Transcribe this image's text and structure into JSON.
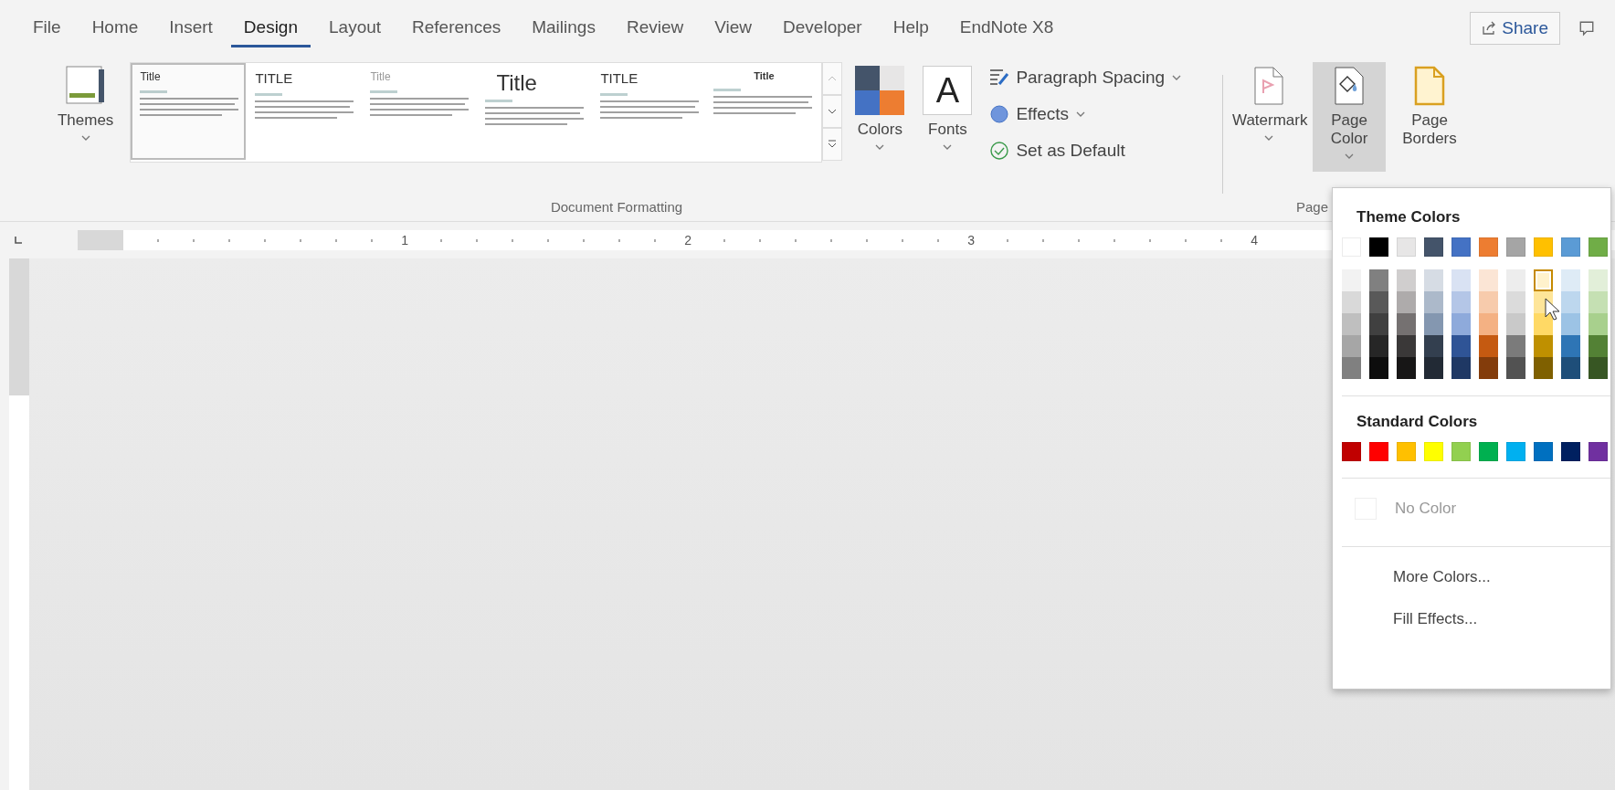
{
  "tabs": [
    {
      "label": "File",
      "selected": false
    },
    {
      "label": "Home",
      "selected": false
    },
    {
      "label": "Insert",
      "selected": false
    },
    {
      "label": "Design",
      "selected": true
    },
    {
      "label": "Layout",
      "selected": false
    },
    {
      "label": "References",
      "selected": false
    },
    {
      "label": "Mailings",
      "selected": false
    },
    {
      "label": "Review",
      "selected": false
    },
    {
      "label": "View",
      "selected": false
    },
    {
      "label": "Developer",
      "selected": false
    },
    {
      "label": "Help",
      "selected": false
    },
    {
      "label": "EndNote X8",
      "selected": false
    }
  ],
  "share_button": {
    "label": "Share"
  },
  "ribbon": {
    "themes_button": {
      "label": "Themes"
    },
    "style_gallery": [
      {
        "title": "Title",
        "kind": "basic",
        "selected": true
      },
      {
        "title": "TITLE",
        "kind": "caps",
        "selected": false
      },
      {
        "title": "Title",
        "kind": "faint",
        "selected": false
      },
      {
        "title": "Title",
        "kind": "large",
        "selected": false
      },
      {
        "title": "TITLE",
        "kind": "caps",
        "selected": false
      },
      {
        "title": "Title",
        "kind": "centered",
        "selected": false
      }
    ],
    "colors_button": {
      "label": "Colors"
    },
    "fonts_button": {
      "label": "Fonts",
      "sample": "A"
    },
    "commands": [
      {
        "label": "Paragraph Spacing",
        "kind": "spacing"
      },
      {
        "label": "Effects",
        "kind": "effects"
      },
      {
        "label": "Set as Default",
        "kind": "default"
      }
    ],
    "document_group_label": "Document Formatting",
    "page_buttons": [
      {
        "label": "Watermark",
        "kind": "watermark",
        "active": false
      },
      {
        "label": "Page Color",
        "kind": "page-color",
        "active": true
      },
      {
        "label": "Page Borders",
        "kind": "page-borders",
        "active": false
      }
    ],
    "page_group_label": "Page"
  },
  "ruler": {
    "numbers": [
      "1",
      "2",
      "3",
      "4"
    ]
  },
  "page_color_menu": {
    "theme_heading": "Theme Colors",
    "theme_colors": [
      {
        "color": "#ffffff",
        "shades": [
          {
            "color": "#f2f2f2",
            "selected": false
          },
          {
            "color": "#d9d9d9",
            "selected": false
          },
          {
            "color": "#bfbfbf",
            "selected": false
          },
          {
            "color": "#a6a6a6",
            "selected": false
          },
          {
            "color": "#808080",
            "selected": false
          }
        ]
      },
      {
        "color": "#000000",
        "shades": [
          {
            "color": "#808080",
            "selected": false
          },
          {
            "color": "#595959",
            "selected": false
          },
          {
            "color": "#404040",
            "selected": false
          },
          {
            "color": "#262626",
            "selected": false
          },
          {
            "color": "#0d0d0d",
            "selected": false
          }
        ]
      },
      {
        "color": "#e7e6e6",
        "shades": [
          {
            "color": "#d0cece",
            "selected": false
          },
          {
            "color": "#aeabab",
            "selected": false
          },
          {
            "color": "#757171",
            "selected": false
          },
          {
            "color": "#3a3838",
            "selected": false
          },
          {
            "color": "#171616",
            "selected": false
          }
        ]
      },
      {
        "color": "#44546a",
        "shades": [
          {
            "color": "#d6dce4",
            "selected": false
          },
          {
            "color": "#acb9ca",
            "selected": false
          },
          {
            "color": "#8497b0",
            "selected": false
          },
          {
            "color": "#333f4f",
            "selected": false
          },
          {
            "color": "#222a35",
            "selected": false
          }
        ]
      },
      {
        "color": "#4472c4",
        "shades": [
          {
            "color": "#d9e2f3",
            "selected": false
          },
          {
            "color": "#b4c6e7",
            "selected": false
          },
          {
            "color": "#8eaadb",
            "selected": false
          },
          {
            "color": "#2f5496",
            "selected": false
          },
          {
            "color": "#1f3864",
            "selected": false
          }
        ]
      },
      {
        "color": "#ed7d31",
        "shades": [
          {
            "color": "#fbe5d5",
            "selected": false
          },
          {
            "color": "#f7cbac",
            "selected": false
          },
          {
            "color": "#f4b183",
            "selected": false
          },
          {
            "color": "#c55a11",
            "selected": false
          },
          {
            "color": "#833c0b",
            "selected": false
          }
        ]
      },
      {
        "color": "#a5a5a5",
        "shades": [
          {
            "color": "#ededed",
            "selected": false
          },
          {
            "color": "#dbdbdb",
            "selected": false
          },
          {
            "color": "#c9c9c9",
            "selected": false
          },
          {
            "color": "#7b7b7b",
            "selected": false
          },
          {
            "color": "#525252",
            "selected": false
          }
        ]
      },
      {
        "color": "#ffc000",
        "shades": [
          {
            "color": "#fff2cc",
            "selected": true
          },
          {
            "color": "#fee599",
            "selected": false
          },
          {
            "color": "#ffd965",
            "selected": false
          },
          {
            "color": "#bf9000",
            "selected": false
          },
          {
            "color": "#7f6000",
            "selected": false
          }
        ]
      },
      {
        "color": "#5b9bd5",
        "shades": [
          {
            "color": "#deebf6",
            "selected": false
          },
          {
            "color": "#bdd7ee",
            "selected": false
          },
          {
            "color": "#9cc3e5",
            "selected": false
          },
          {
            "color": "#2e75b5",
            "selected": false
          },
          {
            "color": "#1e4e79",
            "selected": false
          }
        ]
      },
      {
        "color": "#70ad47",
        "shades": [
          {
            "color": "#e2efd9",
            "selected": false
          },
          {
            "color": "#c5e0b3",
            "selected": false
          },
          {
            "color": "#a8d08d",
            "selected": false
          },
          {
            "color": "#538135",
            "selected": false
          },
          {
            "color": "#375623",
            "selected": false
          }
        ]
      }
    ],
    "standard_heading": "Standard Colors",
    "standard_colors": [
      {
        "color": "#c00000"
      },
      {
        "color": "#ff0000"
      },
      {
        "color": "#ffc000"
      },
      {
        "color": "#ffff00"
      },
      {
        "color": "#92d050"
      },
      {
        "color": "#00b050"
      },
      {
        "color": "#00b0f0"
      },
      {
        "color": "#0070c0"
      },
      {
        "color": "#002060"
      },
      {
        "color": "#7030a0"
      }
    ],
    "items": [
      {
        "label": "No Color",
        "kind": "no-color",
        "disabled": true
      },
      {
        "label": "More Colors...",
        "kind": "plain",
        "disabled": false
      },
      {
        "label": "Fill Effects...",
        "kind": "plain",
        "disabled": false
      }
    ]
  }
}
